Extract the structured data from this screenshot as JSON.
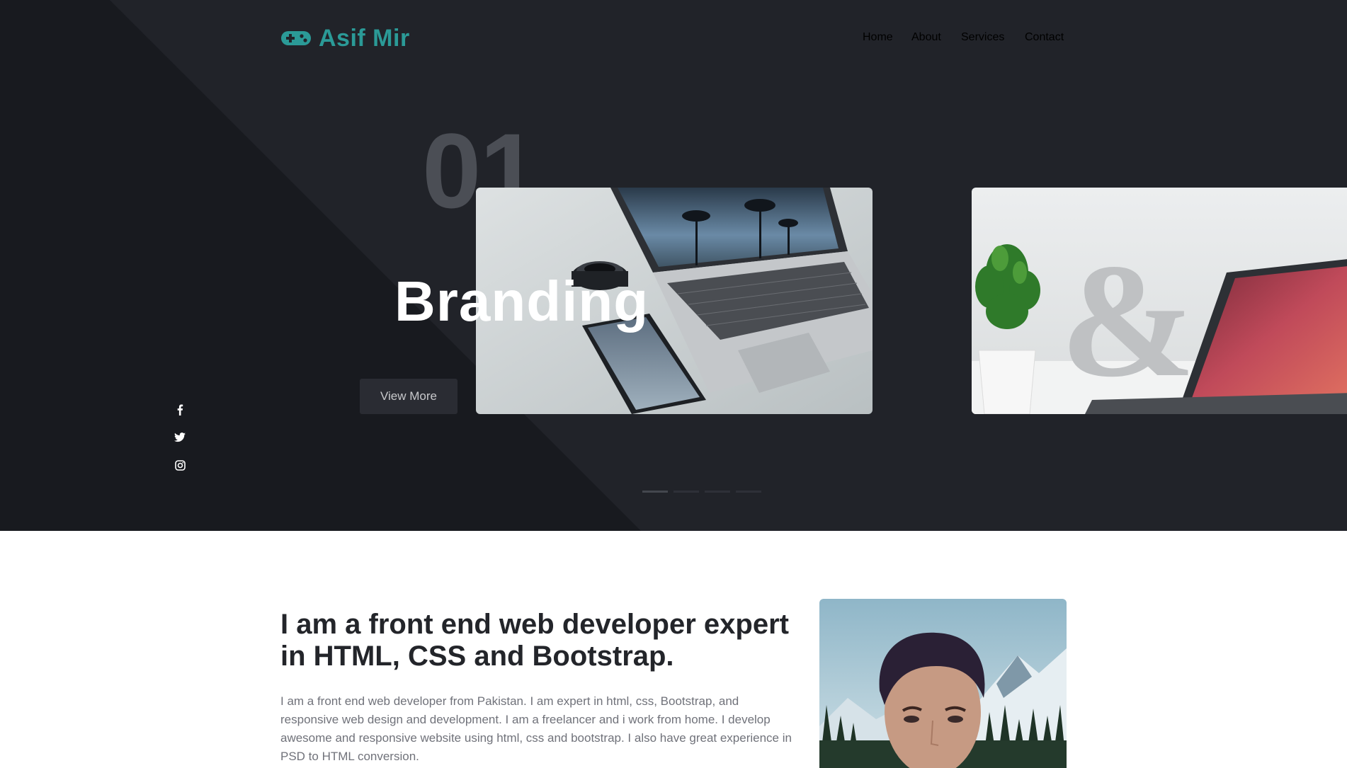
{
  "brand": {
    "name": "Asif Mir",
    "icon": "gamepad-icon",
    "color": "#2b9a97"
  },
  "nav": [
    {
      "label": "Home",
      "active": true
    },
    {
      "label": "About",
      "active": false
    },
    {
      "label": "Services",
      "active": false
    },
    {
      "label": "Contact",
      "active": false
    }
  ],
  "hero": {
    "number": "01",
    "title": "Branding",
    "button_label": "View More",
    "slides": [
      "laptop-phone-photo",
      "ampersand-plant-laptop-photo"
    ],
    "active_dot": 0,
    "dot_count": 4
  },
  "social": [
    {
      "icon": "facebook-icon"
    },
    {
      "icon": "twitter-icon"
    },
    {
      "icon": "instagram-icon"
    }
  ],
  "about": {
    "heading": "I am a front end web developer expert in HTML, CSS and Bootstrap.",
    "paragraph": "I am a front end web developer from Pakistan. I am expert in html, css, Bootstrap, and responsive web design and development. I am a freelancer and i work from home. I develop awesome and responsive website using html, css and bootstrap. I also have great experience in PSD to HTML conversion."
  },
  "colors": {
    "hero_bg": "#212329",
    "hero_dark": "#181a1f",
    "accent": "#2b9a97"
  }
}
